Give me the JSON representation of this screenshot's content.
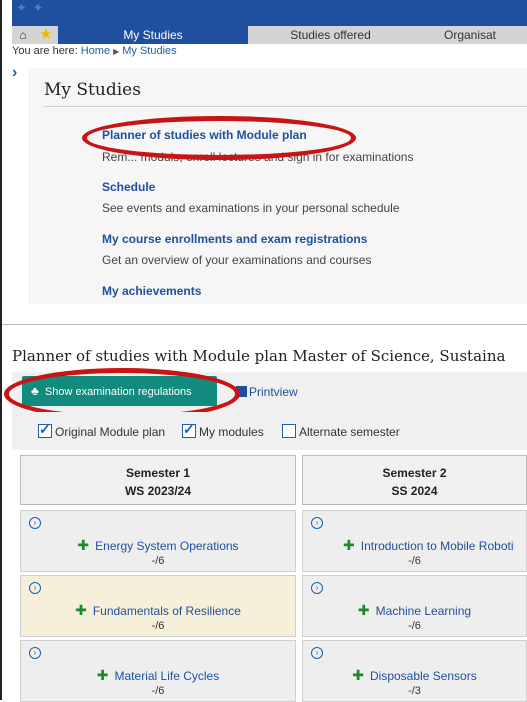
{
  "nav": {
    "home_icon": "home-icon",
    "star_icon": "star-icon",
    "tabs": [
      "My Studies",
      "Studies offered",
      "Organisat"
    ]
  },
  "breadcrumb": {
    "prefix": "You are here:",
    "items": [
      "Home",
      "My Studies"
    ]
  },
  "panel": {
    "title": "My Studies",
    "links": [
      {
        "title": "Planner of studies with Module plan",
        "desc": "Rem... moduls, enroll lectures and sign in for examinations"
      },
      {
        "title": "Schedule",
        "desc": "See events and examinations in your personal schedule"
      },
      {
        "title": "My course enrollments and exam registrations",
        "desc": "Get an overview of your examinations and courses"
      },
      {
        "title": "My achievements",
        "desc": ""
      }
    ]
  },
  "planner": {
    "title": "Planner of studies with Module plan Master of Science, Sustaina",
    "show_exam_label": "Show examination regulations",
    "printview_label": "Printview",
    "checkboxes": [
      {
        "label": "Original Module plan",
        "checked": true
      },
      {
        "label": "My modules",
        "checked": true
      },
      {
        "label": "Alternate semester",
        "checked": false
      }
    ],
    "semesters": [
      {
        "name": "Semester 1",
        "term": "WS 2023/24"
      },
      {
        "name": "Semester 2",
        "term": "SS 2024"
      }
    ],
    "modules": [
      [
        {
          "name": "Energy System Operations",
          "credits": "-/6"
        },
        {
          "name": "Fundamentals of Resilience",
          "credits": "-/6"
        },
        {
          "name": "Material Life Cycles",
          "credits": "-/6"
        }
      ],
      [
        {
          "name": "Introduction to Mobile Roboti",
          "credits": "-/6"
        },
        {
          "name": "Machine Learning",
          "credits": "-/6"
        },
        {
          "name": "Disposable Sensors",
          "credits": "-/3"
        }
      ]
    ]
  },
  "colors": {
    "nav_blue": "#1f4f9e",
    "teal": "#128b7f",
    "highlight_red": "#c81414",
    "puzzle_green": "#1f8a2a"
  }
}
